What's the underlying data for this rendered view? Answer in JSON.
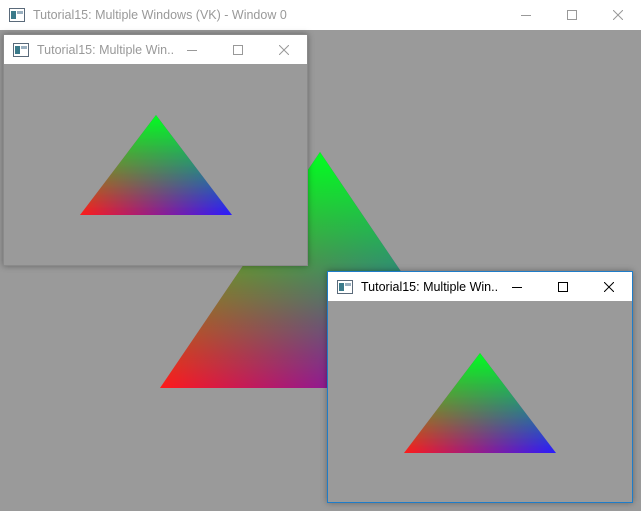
{
  "main_window": {
    "title": "Tutorial15: Multiple Windows (VK) - Window 0",
    "icon": "app-window-icon",
    "buttons": [
      "minimize-icon",
      "maximize-icon",
      "close-icon"
    ]
  },
  "child_window_1": {
    "title": "Tutorial15: Multiple Win...",
    "icon": "app-window-icon",
    "active": false
  },
  "child_window_2": {
    "title": "Tutorial15: Multiple Win...",
    "icon": "app-window-icon",
    "active": true
  },
  "render": {
    "clear_color": "#9a9a9a",
    "vertex_colors": {
      "top": "#00ff20",
      "bottom_left": "#ff1a1a",
      "bottom_right": "#2a1aff"
    }
  }
}
